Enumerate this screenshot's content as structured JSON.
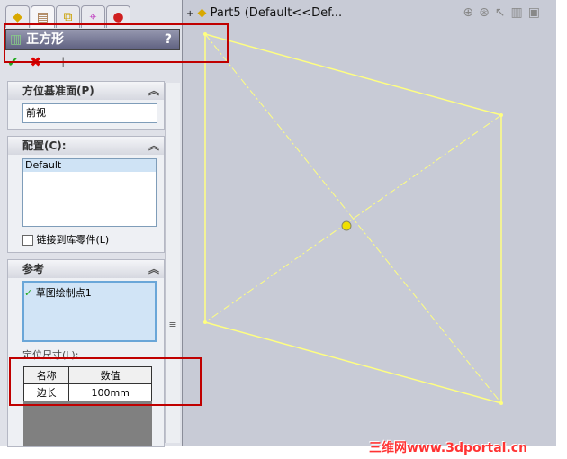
{
  "tabs": [
    "feature-manager",
    "property-manager",
    "configuration-manager",
    "dimxpert",
    "display-manager"
  ],
  "panel": {
    "title": "正方形",
    "help": "?"
  },
  "actions": {
    "ok": "✔",
    "cancel": "✖",
    "pin": "⊣"
  },
  "orientation": {
    "header": "方位基准面(P)",
    "value": "前视"
  },
  "config": {
    "header": "配置(C):",
    "items": [
      "Default"
    ],
    "link_label": "链接到库零件(L)"
  },
  "reference": {
    "header": "参考",
    "items": [
      "草图绘制点1"
    ]
  },
  "dims": {
    "label": "定位尺寸(L):",
    "headers": [
      "名称",
      "数值"
    ],
    "rows": [
      [
        "边长",
        "100mm"
      ]
    ]
  },
  "tree": {
    "expand": "+",
    "title": "Part5  (Default<<Def..."
  },
  "watermark": "三维网www.3dportal.cn",
  "colors": {
    "sketch": "#ffff80",
    "highlight": "#c00000"
  }
}
